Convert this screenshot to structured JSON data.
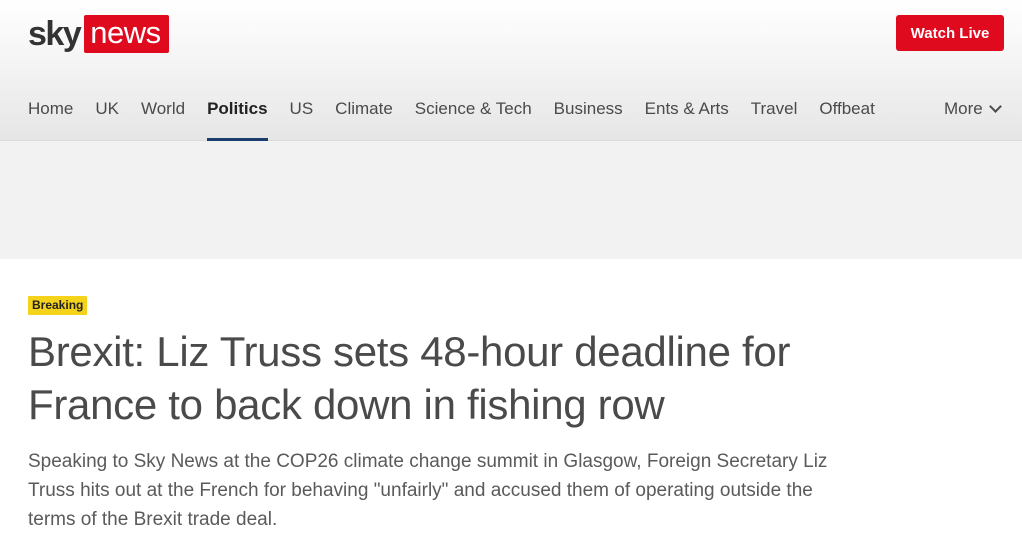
{
  "header": {
    "logo_sky": "sky",
    "logo_news": "news",
    "watch_live_label": "Watch Live"
  },
  "nav": {
    "items": [
      {
        "label": "Home"
      },
      {
        "label": "UK"
      },
      {
        "label": "World"
      },
      {
        "label": "Politics",
        "active": true
      },
      {
        "label": "US"
      },
      {
        "label": "Climate"
      },
      {
        "label": "Science & Tech"
      },
      {
        "label": "Business"
      },
      {
        "label": "Ents & Arts"
      },
      {
        "label": "Travel"
      },
      {
        "label": "Offbeat"
      }
    ],
    "more_label": "More",
    "more_icon": "chevron-down-icon"
  },
  "article": {
    "badge": "Breaking",
    "headline": "Brexit: Liz Truss sets 48-hour deadline for France to back down in fishing row",
    "standfirst": "Speaking to Sky News at the COP26 climate change summit in Glasgow, Foreign Secretary Liz Truss hits out at the French for behaving \"unfairly\" and accused them of operating outside the terms of the Brexit trade deal."
  },
  "colors": {
    "brand_red": "#e00a1f",
    "active_underline": "#1d3c6e",
    "breaking_yellow": "#f5d31b"
  }
}
